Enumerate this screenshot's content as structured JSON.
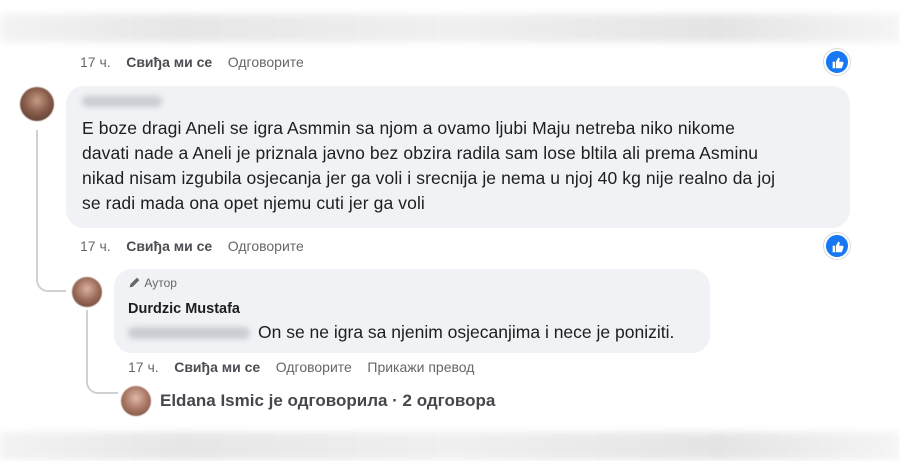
{
  "comment1": {
    "time": "17 ч.",
    "like_label": "Свиђа ми се",
    "reply_label": "Одговорите",
    "text_lines": [
      "E boze dragi Aneli se igra Asmmin sa njom a ovamo ljubi Maju netreba niko nikome",
      "davati nade a Aneli je priznala javno bez obzira radila sam lose bltila ali prema Asminu",
      "nikad nisam izgubila osjecanja jer ga voli i srecnija je nema u njoj 40 kg nije realno da joj",
      "se radi mada ona opet njemu cuti jer ga voli"
    ]
  },
  "top_actions": {
    "time": "17 ч.",
    "like_label": "Свиђа ми се",
    "reply_label": "Одговорите"
  },
  "reply": {
    "badge": "Аутор",
    "author": "Durdzic Mustafa",
    "text": "On se ne igra sa njenim osjecanjima i nece je poniziti.",
    "time": "17 ч.",
    "like_label": "Свиђа ми се",
    "reply_label": "Одговорите",
    "translate_label": "Прикажи превод"
  },
  "more_replies": {
    "text": "Eldana Ismic је одговорила · 2 одговора"
  },
  "icons": {
    "like": "like-thumb-icon",
    "author": "pencil-icon"
  },
  "colors": {
    "like_blue": "#1877f2",
    "bubble": "#f0f2f5",
    "meta": "#65676b"
  }
}
